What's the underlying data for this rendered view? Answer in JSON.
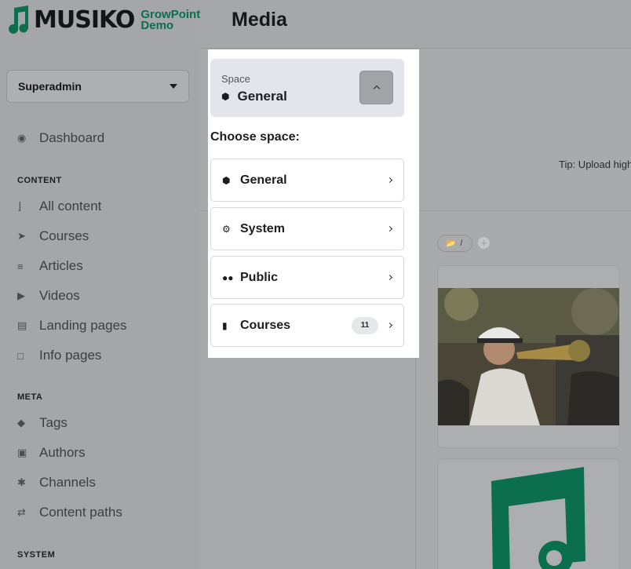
{
  "app": {
    "logo_text": "MUSIKO",
    "logo_sub_line1": "GrowPoint",
    "logo_sub_line2": "Demo",
    "brand_color": "#0b6e4c"
  },
  "sidebar": {
    "role": "Superadmin",
    "dashboard": "Dashboard",
    "sections": {
      "content": "CONTENT",
      "meta": "META",
      "system": "SYSTEM"
    },
    "content_items": [
      {
        "label": "All content",
        "icon": "rss-icon"
      },
      {
        "label": "Courses",
        "icon": "rocket-icon"
      },
      {
        "label": "Articles",
        "icon": "align-left-icon"
      },
      {
        "label": "Videos",
        "icon": "play-icon"
      },
      {
        "label": "Landing pages",
        "icon": "newspaper-icon"
      },
      {
        "label": "Info pages",
        "icon": "file-icon"
      }
    ],
    "meta_items": [
      {
        "label": "Tags",
        "icon": "tag-icon"
      },
      {
        "label": "Authors",
        "icon": "id-card-icon"
      },
      {
        "label": "Channels",
        "icon": "asterisk-icon"
      },
      {
        "label": "Content paths",
        "icon": "shuffle-icon"
      }
    ]
  },
  "header": {
    "title": "Media"
  },
  "main": {
    "tip": "Tip: Upload high",
    "folder_path": "/"
  },
  "space_picker": {
    "label": "Space",
    "current": "General",
    "choose_label": "Choose space:",
    "options": [
      {
        "label": "General",
        "icon": "cube-icon"
      },
      {
        "label": "System",
        "icon": "gear-icon"
      },
      {
        "label": "Public",
        "icon": "users-icon"
      },
      {
        "label": "Courses",
        "icon": "book-icon",
        "count": "11"
      }
    ]
  }
}
